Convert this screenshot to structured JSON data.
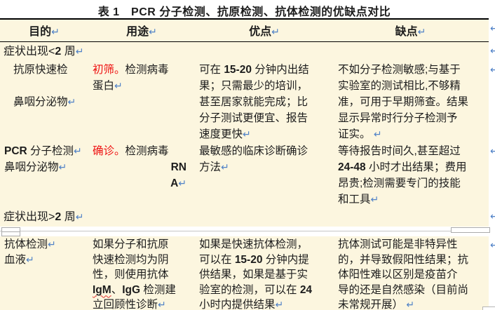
{
  "title": "表 1　PCR 分子检测、抗原检测、抗体检测的优缺点对比",
  "paragraph_mark": "↵",
  "colors": {
    "table_background": "#FCF6DF",
    "red_text": "#EE1111",
    "break_mark_blue": "#4F81C7",
    "border_black": "#000000",
    "pagebreak_gray": "#C6C6C6"
  },
  "table": {
    "headers": [
      "目的↵",
      "用途↵",
      "优点↵",
      "缺点↵"
    ],
    "rows": [
      {
        "type": "section",
        "runs": [
          {
            "t": "症状出现<"
          },
          {
            "t": "2",
            "c": "lat"
          },
          {
            "t": " 周↵"
          }
        ]
      },
      {
        "type": "data",
        "cells": [
          {
            "paras": [
              {
                "runs": [
                  {
                    "t": "抗原快速检"
                  }
                ],
                "indent": true
              },
              {
                "runs": [
                  {
                    "t": ""
                  }
                ]
              },
              {
                "runs": [
                  {
                    "t": "鼻咽分泌物↵"
                  }
                ],
                "indent": true
              }
            ]
          },
          {
            "paras": [
              {
                "runs": [
                  {
                    "t": "初筛。",
                    "c": "red"
                  },
                  {
                    "t": "检测病毒"
                  }
                ]
              },
              {
                "runs": [
                  {
                    "t": "蛋白↵"
                  }
                ]
              }
            ]
          },
          {
            "paras": [
              {
                "runs": [
                  {
                    "t": "可在 "
                  },
                  {
                    "t": "15-20",
                    "c": "lat"
                  },
                  {
                    "t": " 分钟内出结"
                  }
                ]
              },
              {
                "runs": [
                  {
                    "t": "果；只需最少的培训，"
                  }
                ]
              },
              {
                "runs": [
                  {
                    "t": "甚至居家就能完成；比"
                  }
                ]
              },
              {
                "runs": [
                  {
                    "t": "分子测试更便宜、报告"
                  }
                ]
              },
              {
                "runs": [
                  {
                    "t": "速度更快↵"
                  }
                ]
              }
            ]
          },
          {
            "paras": [
              {
                "runs": [
                  {
                    "t": "不如分子检测敏感;与基于"
                  }
                ]
              },
              {
                "runs": [
                  {
                    "t": "实验室的测试相比,不够精"
                  }
                ]
              },
              {
                "runs": [
                  {
                    "t": "准，可用于早期筛查。结果"
                  }
                ]
              },
              {
                "runs": [
                  {
                    "t": "显示异常时行分子检测予"
                  }
                ]
              },
              {
                "runs": [
                  {
                    "t": "证实。 ↵"
                  }
                ]
              }
            ]
          }
        ]
      },
      {
        "type": "data",
        "cells": [
          {
            "paras": [
              {
                "runs": [
                  {
                    "t": "PCR",
                    "c": "lat"
                  },
                  {
                    "t": " 分子检测↵"
                  }
                ]
              },
              {
                "runs": [
                  {
                    "t": "鼻咽分泌物↵"
                  }
                ]
              }
            ]
          },
          {
            "paras": [
              {
                "runs": [
                  {
                    "t": "确诊。",
                    "c": "red"
                  },
                  {
                    "t": "检测病毒"
                  }
                ]
              },
              {
                "runs": [
                  {
                    "t": "RN",
                    "c": "lat"
                  }
                ],
                "align": "right"
              },
              {
                "runs": [
                  {
                    "t": "A",
                    "c": "lat"
                  },
                  {
                    "t": "↵"
                  }
                ],
                "align": "right"
              }
            ]
          },
          {
            "paras": [
              {
                "runs": [
                  {
                    "t": "最敏感的临床诊断确诊"
                  }
                ]
              },
              {
                "runs": [
                  {
                    "t": "方法↵"
                  }
                ]
              }
            ]
          },
          {
            "paras": [
              {
                "runs": [
                  {
                    "t": "等待报告时间久,甚至超过"
                  }
                ]
              },
              {
                "runs": [
                  {
                    "t": "24-48",
                    "c": "lat"
                  },
                  {
                    "t": " 小时才出结果；费用"
                  }
                ]
              },
              {
                "runs": [
                  {
                    "t": "昂贵;检测需要专门的技能"
                  }
                ]
              },
              {
                "runs": [
                  {
                    "t": "和工具↵"
                  }
                ]
              }
            ]
          }
        ]
      },
      {
        "type": "section",
        "runs": [
          {
            "t": "症状出现>"
          },
          {
            "t": "2",
            "c": "lat"
          },
          {
            "t": " 周↵"
          }
        ]
      },
      {
        "type": "pagebreak"
      },
      {
        "type": "data",
        "compact": true,
        "cells": [
          {
            "paras": [
              {
                "runs": [
                  {
                    "t": "抗体检测↵"
                  }
                ]
              },
              {
                "runs": [
                  {
                    "t": "血液↵"
                  }
                ]
              }
            ]
          },
          {
            "paras": [
              {
                "runs": [
                  {
                    "t": "如果分子和抗原"
                  }
                ]
              },
              {
                "runs": [
                  {
                    "t": "快速检测均为阴"
                  }
                ]
              },
              {
                "runs": [
                  {
                    "t": "性，则使用抗体"
                  }
                ]
              },
              {
                "runs": [
                  {
                    "t": "IgM",
                    "c": "sq"
                  },
                  {
                    "t": "、"
                  },
                  {
                    "t": "IgG",
                    "c": "lat"
                  },
                  {
                    "t": " 检测建"
                  }
                ]
              },
              {
                "runs": [
                  {
                    "t": "立回顾性诊断↵"
                  }
                ]
              }
            ]
          },
          {
            "paras": [
              {
                "runs": [
                  {
                    "t": "如果是快速抗体检测，"
                  }
                ]
              },
              {
                "runs": [
                  {
                    "t": "可以在 "
                  },
                  {
                    "t": "15-20",
                    "c": "lat"
                  },
                  {
                    "t": " 分钟内提"
                  }
                ]
              },
              {
                "runs": [
                  {
                    "t": "供结果，如果是基于实"
                  }
                ]
              },
              {
                "runs": [
                  {
                    "t": "验室的检测，可以在 "
                  },
                  {
                    "t": "24",
                    "c": "lat"
                  }
                ]
              },
              {
                "runs": [
                  {
                    "t": "小时内提供结果↵"
                  }
                ]
              }
            ]
          },
          {
            "paras": [
              {
                "runs": [
                  {
                    "t": "抗体测试可能是非特异性"
                  }
                ]
              },
              {
                "runs": [
                  {
                    "t": "的，并导致假阳性结果；抗"
                  }
                ]
              },
              {
                "runs": [
                  {
                    "t": "体阳性难以区别是疫苗介"
                  }
                ]
              },
              {
                "runs": [
                  {
                    "t": "导的还是自然感染（目前尚"
                  }
                ]
              },
              {
                "runs": [
                  {
                    "t": "未常规开展） ↵"
                  }
                ]
              }
            ]
          }
        ]
      }
    ]
  }
}
